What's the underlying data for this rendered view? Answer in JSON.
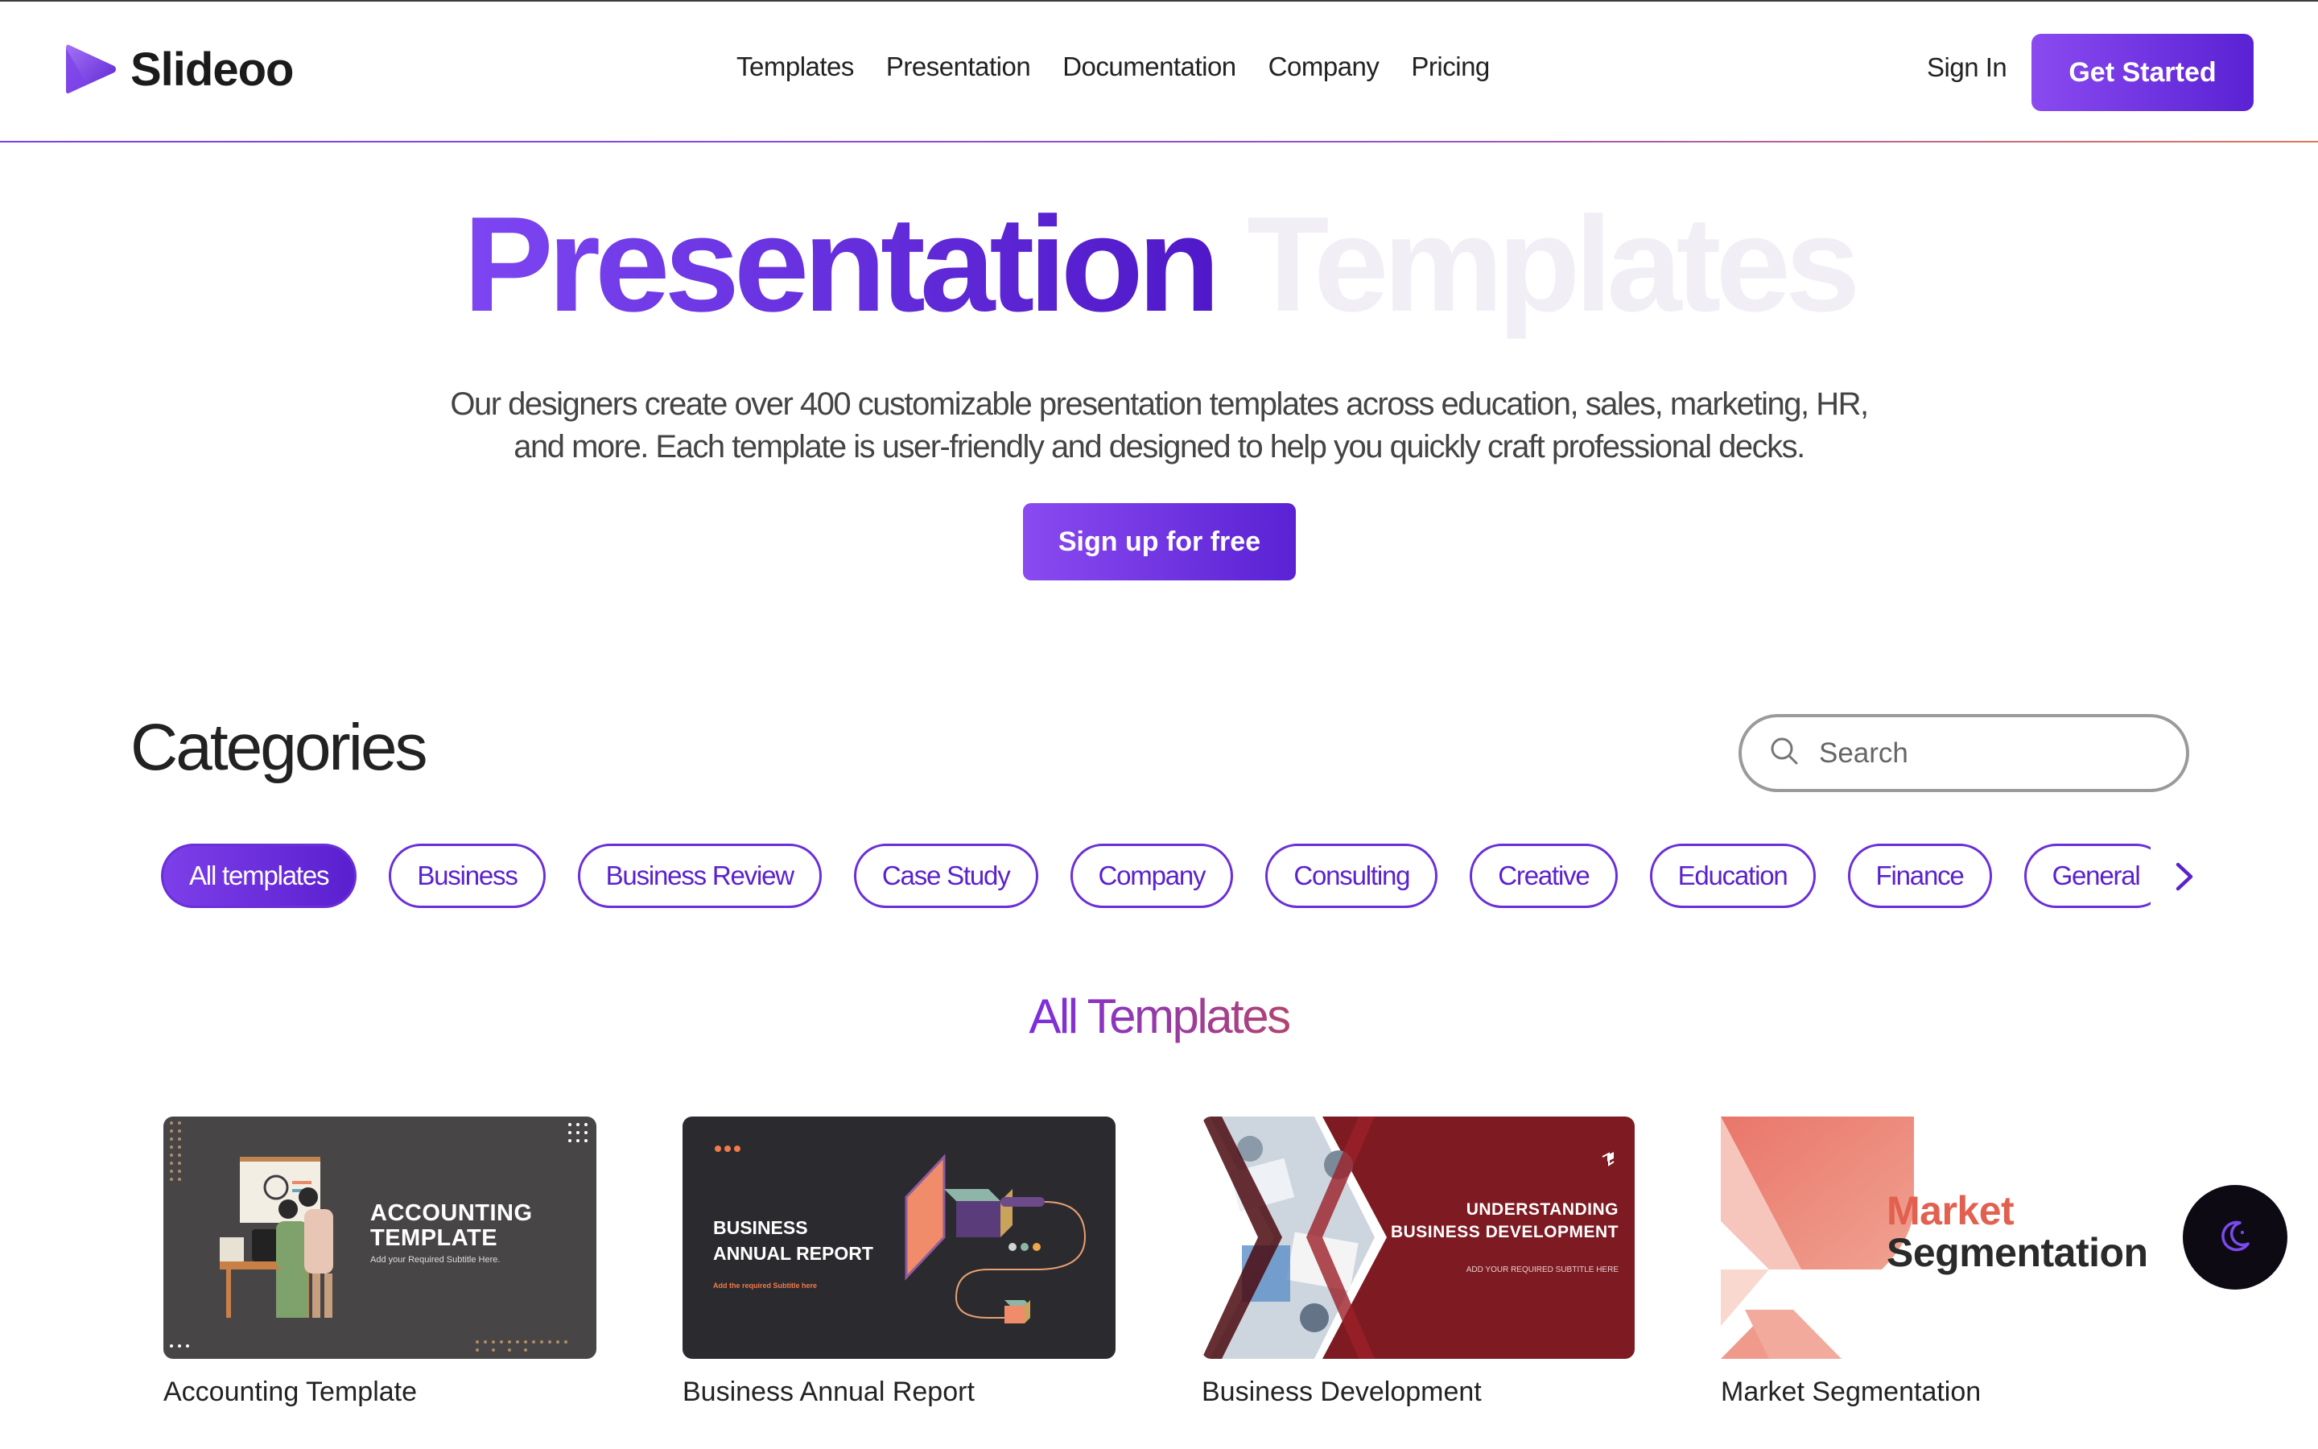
{
  "brand": {
    "name": "Slideoo",
    "accent": "#6a2fd8"
  },
  "nav": {
    "items": [
      "Templates",
      "Presentation",
      "Documentation",
      "Company",
      "Pricing"
    ]
  },
  "header": {
    "sign_in": "Sign In",
    "get_started": "Get Started"
  },
  "hero": {
    "title_primary": "Presentation",
    "title_secondary": "Templates",
    "subtitle_line1": "Our designers create over 400 customizable presentation templates across education, sales, marketing, HR,",
    "subtitle_line2": "and more. Each template is user-friendly and designed to help you quickly craft professional decks.",
    "cta": "Sign up for free"
  },
  "categories": {
    "title": "Categories",
    "search_placeholder": "Search",
    "chips": [
      "All templates",
      "Business",
      "Business Review",
      "Case Study",
      "Company",
      "Consulting",
      "Creative",
      "Education",
      "Finance",
      "General"
    ],
    "active_index": 0
  },
  "templates": {
    "title": "All Templates",
    "cards": [
      {
        "label": "Accounting Template",
        "thumb_title_1": "ACCOUNTING",
        "thumb_title_2": "TEMPLATE",
        "thumb_sub": "Add your Required Subtitle Here."
      },
      {
        "label": "Business Annual Report",
        "thumb_title_1": "BUSINESS",
        "thumb_title_2": "ANNUAL REPORT",
        "thumb_sub": "Add the required Subtitle here"
      },
      {
        "label": "Business Development",
        "thumb_title_1": "UNDERSTANDING",
        "thumb_title_2": "BUSINESS DEVELOPMENT",
        "thumb_sub": "ADD YOUR REQUIRED SUBTITLE HERE"
      },
      {
        "label": "Market Segmentation",
        "thumb_title_1": "Market",
        "thumb_title_2": "Segmentation"
      }
    ]
  },
  "icons": {
    "logo": "play-triangle-icon",
    "search": "search-icon",
    "next": "chevron-right-icon",
    "theme": "moon-icon"
  }
}
